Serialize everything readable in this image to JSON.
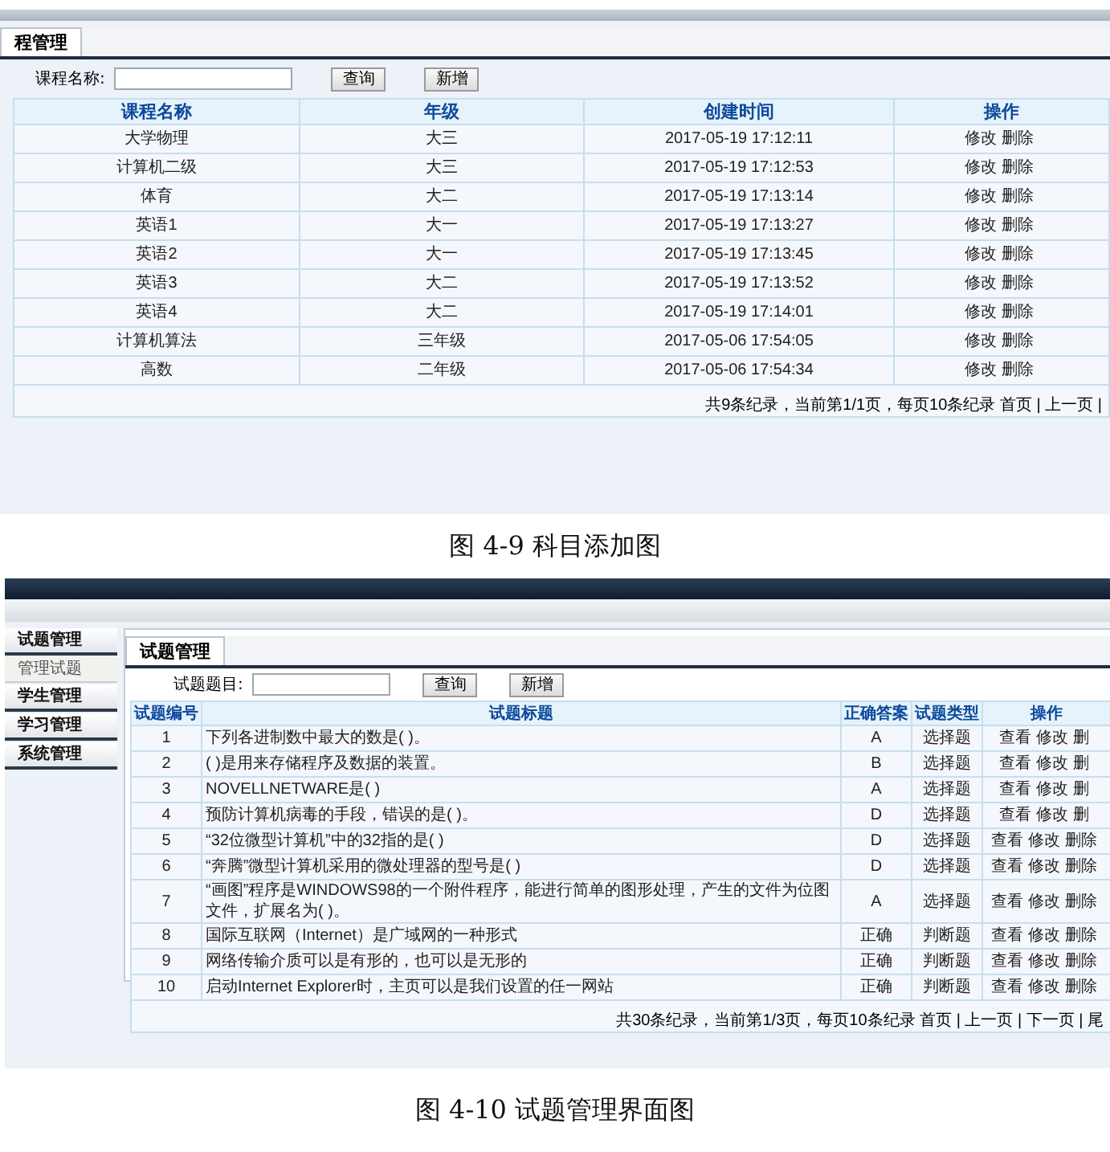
{
  "course_screen": {
    "tab": "程管理",
    "search": {
      "label": "课程名称:",
      "buttons": [
        "查询",
        "新增"
      ]
    },
    "table": {
      "columns": [
        "课程名称",
        "年级",
        "创建时间",
        "操作"
      ],
      "rows": [
        {
          "cells": [
            "大学物理",
            "大三",
            "2017-05-19 17:12:11"
          ],
          "actions": [
            "修改",
            "删除"
          ]
        },
        {
          "cells": [
            "计算机二级",
            "大三",
            "2017-05-19 17:12:53"
          ],
          "actions": [
            "修改",
            "删除"
          ]
        },
        {
          "cells": [
            "体育",
            "大二",
            "2017-05-19 17:13:14"
          ],
          "actions": [
            "修改",
            "删除"
          ]
        },
        {
          "cells": [
            "英语1",
            "大一",
            "2017-05-19 17:13:27"
          ],
          "actions": [
            "修改",
            "删除"
          ]
        },
        {
          "cells": [
            "英语2",
            "大一",
            "2017-05-19 17:13:45"
          ],
          "actions": [
            "修改",
            "删除"
          ]
        },
        {
          "cells": [
            "英语3",
            "大二",
            "2017-05-19 17:13:52"
          ],
          "actions": [
            "修改",
            "删除"
          ]
        },
        {
          "cells": [
            "英语4",
            "大二",
            "2017-05-19 17:14:01"
          ],
          "actions": [
            "修改",
            "删除"
          ]
        },
        {
          "cells": [
            "计算机算法",
            "三年级",
            "2017-05-06 17:54:05"
          ],
          "actions": [
            "修改",
            "删除"
          ]
        },
        {
          "cells": [
            "高数",
            "二年级",
            "2017-05-06 17:54:34"
          ],
          "actions": [
            "修改",
            "删除"
          ]
        }
      ],
      "pager": "共9条纪录，当前第1/1页，每页10条纪录 首页 | 上一页 |"
    }
  },
  "course_caption": "图 4-9 科目添加图",
  "exam_screen": {
    "sidebar": [
      {
        "label": "试题管理",
        "kind": "header",
        "selected": false
      },
      {
        "label": "管理试题",
        "kind": "sub",
        "selected": true
      },
      {
        "label": "学生管理",
        "kind": "header",
        "selected": false
      },
      {
        "label": "学习管理",
        "kind": "header",
        "selected": false
      },
      {
        "label": "系统管理",
        "kind": "header",
        "selected": false
      }
    ],
    "tab": "试题管理",
    "search": {
      "label": "试题题目:",
      "buttons": [
        "查询",
        "新增"
      ]
    },
    "table": {
      "columns": [
        "试题编号",
        "试题标题",
        "正确答案",
        "试题类型",
        "操作"
      ],
      "rows": [
        {
          "cells": [
            "1",
            "下列各进制数中最大的数是( )。",
            "A",
            "选择题"
          ],
          "actions": [
            "查看",
            "修改",
            "删"
          ]
        },
        {
          "cells": [
            "2",
            "( )是用来存储程序及数据的装置。",
            "B",
            "选择题"
          ],
          "actions": [
            "查看",
            "修改",
            "删"
          ]
        },
        {
          "cells": [
            "3",
            "NOVELLNETWARE是( )",
            "A",
            "选择题"
          ],
          "actions": [
            "查看",
            "修改",
            "删"
          ]
        },
        {
          "cells": [
            "4",
            "预防计算机病毒的手段，错误的是( )。",
            "D",
            "选择题"
          ],
          "actions": [
            "查看",
            "修改",
            "删"
          ]
        },
        {
          "cells": [
            "5",
            "“32位微型计算机”中的32指的是( )",
            "D",
            "选择题"
          ],
          "actions": [
            "查看",
            "修改",
            "删除"
          ]
        },
        {
          "cells": [
            "6",
            "“奔腾”微型计算机采用的微处理器的型号是( )",
            "D",
            "选择题"
          ],
          "actions": [
            "查看",
            "修改",
            "删除"
          ]
        },
        {
          "cells": [
            "7",
            "“画图”程序是WINDOWS98的一个附件程序，能进行简单的图形处理，产生的文件为位图文件，扩展名为( )。",
            "A",
            "选择题"
          ],
          "actions": [
            "查看",
            "修改",
            "删除"
          ]
        },
        {
          "cells": [
            "8",
            "国际互联网（Internet）是广域网的一种形式",
            "正确",
            "判断题"
          ],
          "actions": [
            "查看",
            "修改",
            "删除"
          ]
        },
        {
          "cells": [
            "9",
            "网络传输介质可以是有形的，也可以是无形的",
            "正确",
            "判断题"
          ],
          "actions": [
            "查看",
            "修改",
            "删除"
          ]
        },
        {
          "cells": [
            "10",
            "启动Internet Explorer时，主页可以是我们设置的任一网站",
            "正确",
            "判断题"
          ],
          "actions": [
            "查看",
            "修改",
            "删除"
          ]
        }
      ],
      "pager": "共30条纪录，当前第1/3页，每页10条纪录 首页 | 上一页 | 下一页 | 尾"
    }
  },
  "exam_caption": "图 4-10 试题管理界面图"
}
